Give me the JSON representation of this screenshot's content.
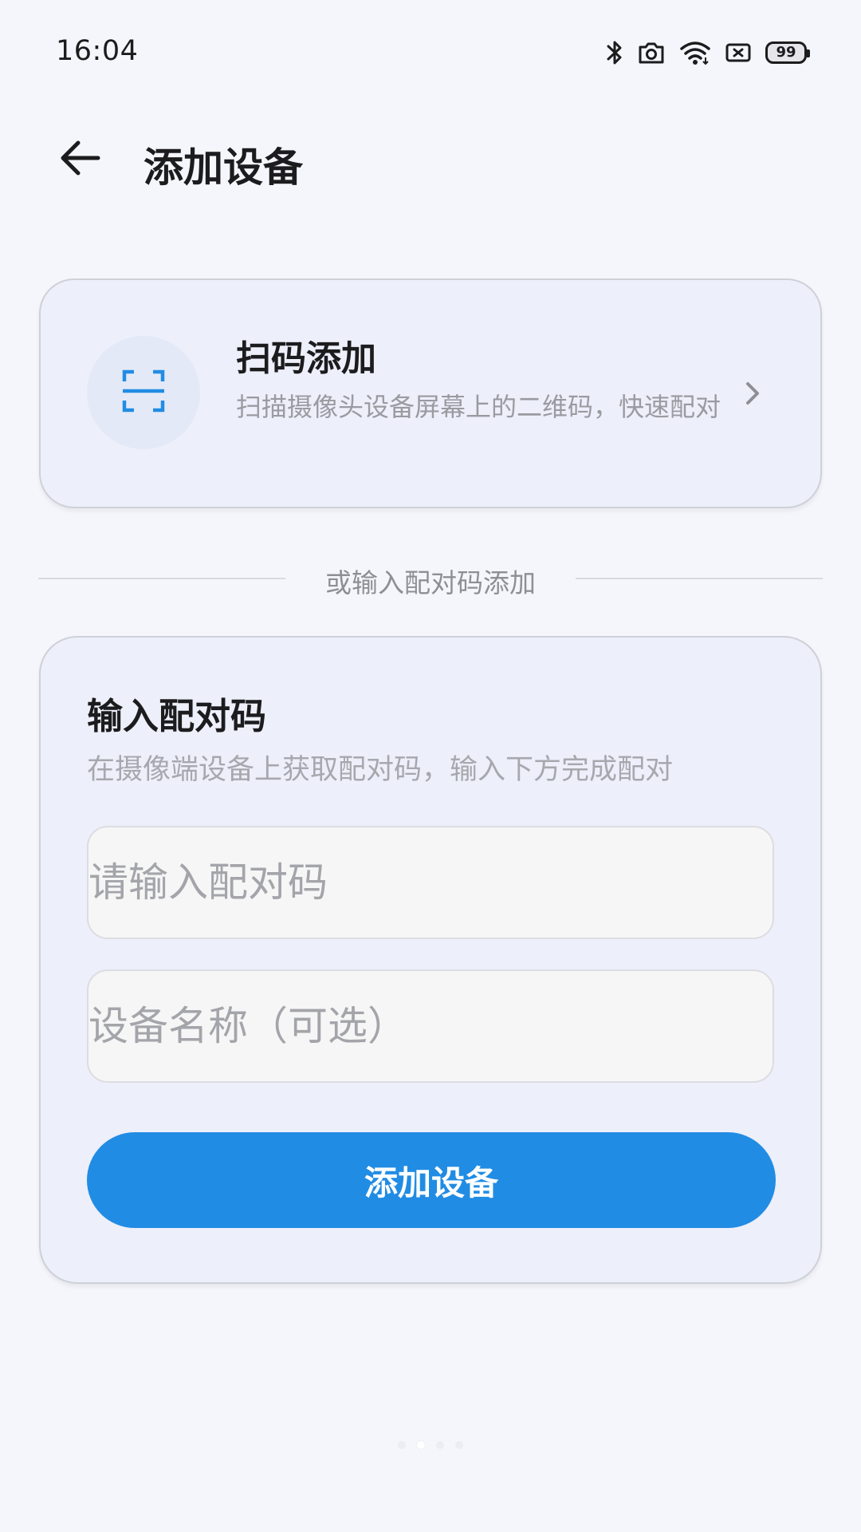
{
  "status_bar": {
    "time": "16:04",
    "battery_level": "99",
    "icons": [
      "bluetooth-icon",
      "camera-icon",
      "wifi-icon",
      "notification-icon",
      "battery-icon"
    ]
  },
  "app_bar": {
    "title": "添加设备",
    "back_icon": "arrow-left-icon"
  },
  "scan_card": {
    "title": "扫码添加",
    "description": "扫描摄像头设备屏幕上的二维码，快速配对",
    "icon": "qr-scan-icon",
    "chevron_icon": "chevron-right-icon"
  },
  "divider": {
    "text": "或输入配对码添加"
  },
  "code_card": {
    "title": "输入配对码",
    "description": "在摄像端设备上获取配对码，输入下方完成配对",
    "code_input": {
      "placeholder": "请输入配对码",
      "value": ""
    },
    "name_input": {
      "placeholder": "设备名称（可选）",
      "value": ""
    },
    "submit_label": "添加设备"
  },
  "colors": {
    "background": "#f5f6fb",
    "card": "#edeffa",
    "accent": "#218ce4",
    "title_text": "#1c1c1e",
    "secondary_text": "#9a9ba1"
  },
  "pager": {
    "count": 4,
    "active_index": 1
  }
}
